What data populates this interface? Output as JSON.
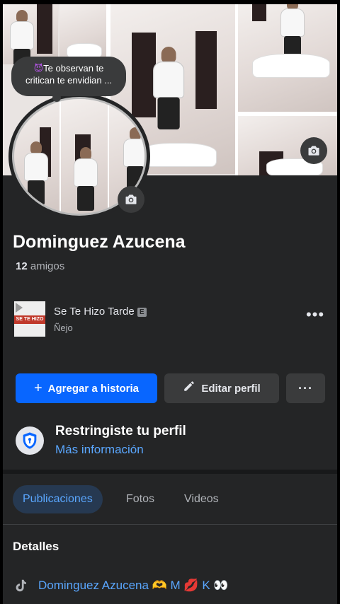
{
  "note": {
    "emoji": "😈",
    "text": "Te observan te critican te envidian ..."
  },
  "profile": {
    "name": "Dominguez Azucena",
    "friends_count": "12",
    "friends_label": "amigos"
  },
  "music": {
    "title": "Se Te Hizo Tarde",
    "explicit_badge": "E",
    "artist": "Ñejo",
    "more": "•••",
    "album_text": "SE TE HIZO"
  },
  "actions": {
    "add_story": "Agregar a historia",
    "edit_profile": "Editar perfil",
    "more": "···"
  },
  "restricted": {
    "title": "Restringiste tu perfil",
    "link": "Más información"
  },
  "tabs": [
    {
      "label": "Publicaciones",
      "active": true
    },
    {
      "label": "Fotos",
      "active": false
    },
    {
      "label": "Videos",
      "active": false
    }
  ],
  "details": {
    "heading": "Detalles",
    "tiktok_link": "Dominguez Azucena 🫶 M 💋 K 👀"
  },
  "colors": {
    "background": "#242526",
    "primary": "#0866ff",
    "link": "#5aa7ff",
    "active_tab_bg": "#263951"
  },
  "icons": [
    "camera-icon",
    "plus-icon",
    "pencil-icon",
    "shield-lock-icon",
    "tiktok-icon",
    "more-icon"
  ]
}
